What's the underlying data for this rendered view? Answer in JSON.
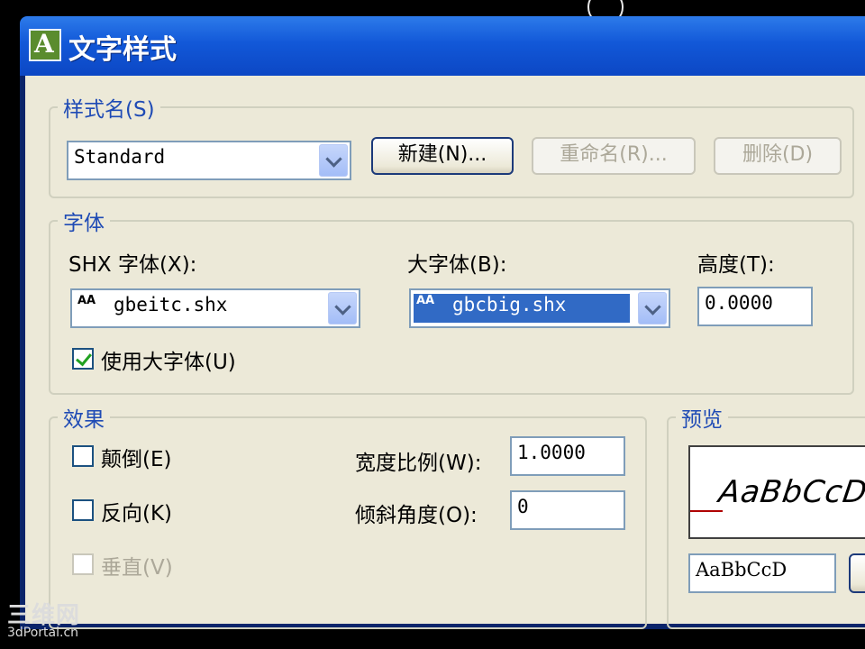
{
  "window": {
    "title": "文字样式"
  },
  "style_name": {
    "group_label": "样式名(S)",
    "selected": "Standard",
    "new_button": "新建(N)...",
    "rename_button": "重命名(R)...",
    "delete_button": "删除(D)"
  },
  "font": {
    "group_label": "字体",
    "shx_label": "SHX 字体(X):",
    "shx_value": "gbeitc.shx",
    "big_label": "大字体(B):",
    "big_value": "gbcbig.shx",
    "height_label": "高度(T):",
    "height_value": "0.0000",
    "use_big_font_label": "使用大字体(U)",
    "use_big_font_checked": true
  },
  "effects": {
    "group_label": "效果",
    "upside_down": {
      "label": "颠倒(E)",
      "checked": false
    },
    "backwards": {
      "label": "反向(K)",
      "checked": false
    },
    "vertical": {
      "label": "垂直(V)",
      "checked": false,
      "disabled": true
    },
    "width_factor_label": "宽度比例(W):",
    "width_factor_value": "1.0000",
    "oblique_label": "倾斜角度(O):",
    "oblique_value": "0"
  },
  "preview": {
    "group_label": "预览",
    "sample_text": "AaBbCcD",
    "input_value": "AaBbCcD"
  },
  "watermark": {
    "line1": "三维网",
    "line2": "3dPortal.cn"
  },
  "colors": {
    "title_bar": "#1258d8",
    "dialog_bg": "#ece9d8",
    "group_label": "#1f4bb5",
    "selection": "#316ac5"
  }
}
